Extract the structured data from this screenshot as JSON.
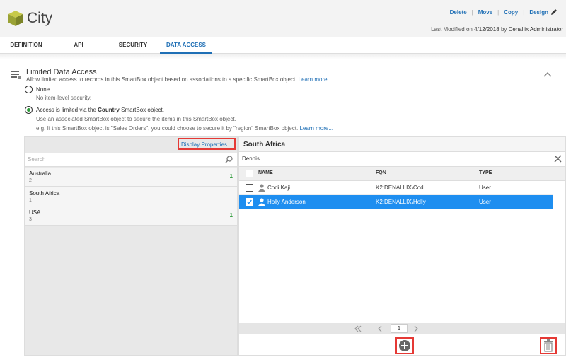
{
  "header": {
    "title": "City",
    "actions": [
      "Delete",
      "Move",
      "Copy",
      "Design"
    ],
    "modified_label": "Last Modified on",
    "modified_date": "4/12/2018",
    "modified_by_label": "by",
    "modified_by": "Denallix Administrator"
  },
  "tabs": [
    "DEFINITION",
    "API",
    "SECURITY",
    "DATA ACCESS"
  ],
  "active_tab": "DATA ACCESS",
  "section": {
    "title": "Limited Data Access",
    "description": "Allow limited access to records in this SmartBox object based on associations to a specific SmartBox object.",
    "learn_more": "Learn more..."
  },
  "options": {
    "none_label": "None",
    "none_sub": "No item-level security.",
    "limited_prefix": "Access is limited via the",
    "limited_object": "Country",
    "limited_suffix": "SmartBox object.",
    "limited_sub1": "Use an associated SmartBox object to secure the items in this SmartBox object.",
    "limited_sub2": "e.g. If this SmartBox object is \"Sales Orders\", you could choose to secure it by \"region\" SmartBox object.",
    "learn_more": "Learn more..."
  },
  "left_panel": {
    "display_properties": "Display Properties...",
    "search_placeholder": "Search",
    "items": [
      {
        "name": "Australia",
        "id": "2",
        "count": "1"
      },
      {
        "name": "South Africa",
        "id": "1",
        "count": ""
      },
      {
        "name": "USA",
        "id": "3",
        "count": "1"
      }
    ]
  },
  "right_panel": {
    "title": "South Africa",
    "filter_value": "Dennis",
    "columns": [
      "NAME",
      "FQN",
      "TYPE"
    ],
    "rows": [
      {
        "name": "Codi Kaji",
        "fqn": "K2:DENALLIX\\Codi",
        "type": "User",
        "checked": false
      },
      {
        "name": "Holly Anderson",
        "fqn": "K2:DENALLIX\\Holly",
        "type": "User",
        "checked": true
      }
    ],
    "page": "1"
  },
  "colors": {
    "accent": "#1f6fb5",
    "selected_row": "#1e8ef0",
    "highlight_border": "#e53935",
    "count_green": "#2e9b3a"
  }
}
